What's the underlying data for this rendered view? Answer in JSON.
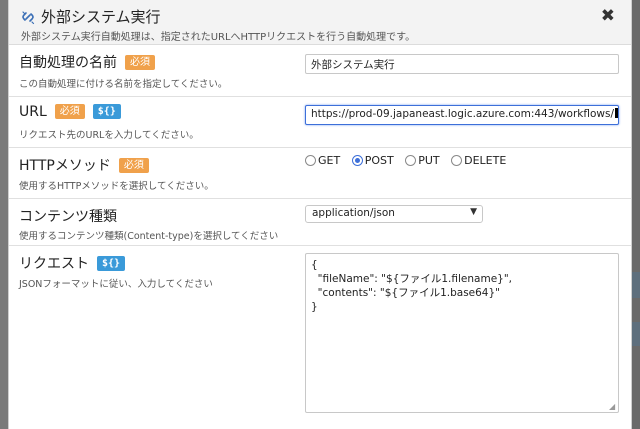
{
  "dialog": {
    "title": "外部システム実行",
    "subtitle": "外部システム実行自動処理は、指定されたURLへHTTPリクエストを行う自動処理です。",
    "close_label": "✖"
  },
  "badges": {
    "required": "必須",
    "variable": "${}"
  },
  "fields": {
    "name": {
      "label": "自動処理の名前",
      "description": "この自動処理に付ける名前を指定してください。",
      "value": "外部システム実行"
    },
    "url": {
      "label": "URL",
      "description": "リクエスト先のURLを入力してください。",
      "value": "https://prod-09.japaneast.logic.azure.com:443/workflows/"
    },
    "method": {
      "label": "HTTPメソッド",
      "description": "使用するHTTPメソッドを選択してください。",
      "options": [
        "GET",
        "POST",
        "PUT",
        "DELETE"
      ],
      "selected": "POST"
    },
    "content_type": {
      "label": "コンテンツ種類",
      "description": "使用するコンテンツ種類(Content-type)を選択してください",
      "value": "application/json"
    },
    "request": {
      "label": "リクエスト",
      "description": "JSONフォーマットに従い、入力してください",
      "body": "{\n  \"fileName\": \"${ファイル1.filename}\",\n  \"contents\": \"${ファイル1.base64}\"\n}"
    }
  },
  "colors": {
    "accent": "#3d6fd9",
    "required_badge": "#f0a14b",
    "variable_badge": "#3a9ad9"
  },
  "icons": {
    "title": "broken-link-icon",
    "close": "close-icon"
  }
}
